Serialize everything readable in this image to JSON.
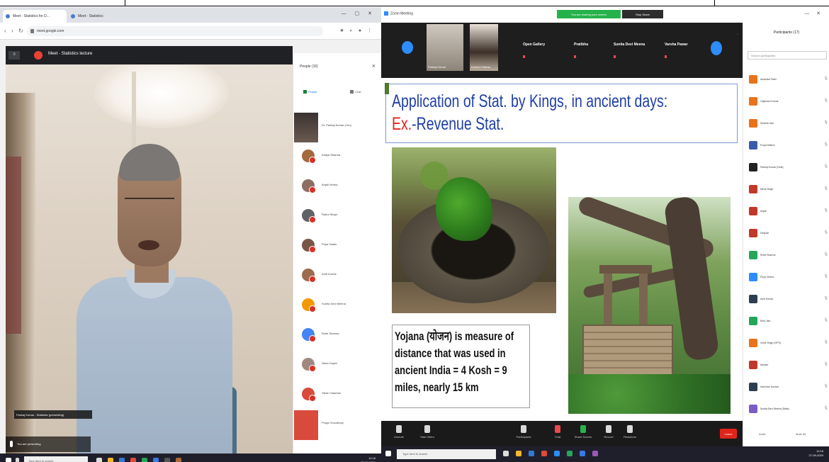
{
  "left": {
    "tabs": [
      {
        "label": "Meet - Statistics for D..."
      },
      {
        "label": "Meet - Statistics"
      }
    ],
    "address": "meet.google.com",
    "meet_title": "Meet - Statistics lecture",
    "speaker_caption": "Pankaj Kumar - Statistics (presenting)",
    "self_label": "You are presenting",
    "people_title": "People (16)",
    "people_tab_people": "People",
    "people_tab_chat": "Chat",
    "participants": [
      {
        "name": "Dr. Pankaj Kumar (You)",
        "thumb": "photo"
      },
      {
        "name": "Aditya Sharma"
      },
      {
        "name": "Anjali Verma"
      },
      {
        "name": "Rahul Singh"
      },
      {
        "name": "Priya Yadav"
      },
      {
        "name": "Amit Kumar"
      },
      {
        "name": "Sunita Devi Meena"
      },
      {
        "name": "Rohit Sharma"
      },
      {
        "name": "Neha Gupta"
      },
      {
        "name": "Vikas Chauhan"
      },
      {
        "name": "Pooja Choudhary",
        "thumb": "red"
      }
    ],
    "taskbar_search": "Type here to search",
    "clock": {
      "time": "11:16",
      "date": "27-09-2020"
    }
  },
  "right": {
    "window_title": "Zoom Meeting",
    "sharing_label": "You are sharing your screen",
    "stop_share_label": "Stop Share",
    "thumbs": [
      "Pankaj Kumar",
      "Kaneez Fatima"
    ],
    "bar_items": [
      "Open Gallery",
      "Pratibha",
      "Sunita Devi Meena",
      "Varsha Pawar"
    ],
    "slide": {
      "title_line1": "Application of Stat. by Kings, in ancient days:",
      "title_ex": "Ex.",
      "title_line2": "-Revenue Stat.",
      "yojana_text": "Yojana (योजन) is measure of distance that was used in ancient India = 4 Kosh = 9 miles, nearly 15 km"
    },
    "controls": [
      {
        "label": "Unmute"
      },
      {
        "label": "Start Video"
      },
      {
        "label": "Participants"
      },
      {
        "label": "Chat",
        "color": "red"
      },
      {
        "label": "Share Screen",
        "color": "green"
      },
      {
        "label": "Record"
      },
      {
        "label": "Reactions"
      }
    ],
    "end_label": "Leave",
    "panel_title": "Participants (17)",
    "panel_search": "Search participants",
    "zparticipants": [
      "Anamika Patel",
      "Gajendra Kumar",
      "Shweta Jain",
      "Pooja Mishra",
      "Pankaj Kumar (Host)",
      "Neha Singh",
      "Anjali",
      "Deepak",
      "Rohit Sharma",
      "Priya Verma",
      "Amit Kumar",
      "Ravi Jain",
      "Vivek Singh (OPS)",
      "Manish",
      "Kanchan Kumari",
      "Sunita Devi Meena (Stats)"
    ],
    "panel_invite": "Invite",
    "panel_mute": "Mute All",
    "taskbar_search": "Type here to search",
    "clock": {
      "time": "11:16",
      "date": "27-09-2020"
    }
  }
}
